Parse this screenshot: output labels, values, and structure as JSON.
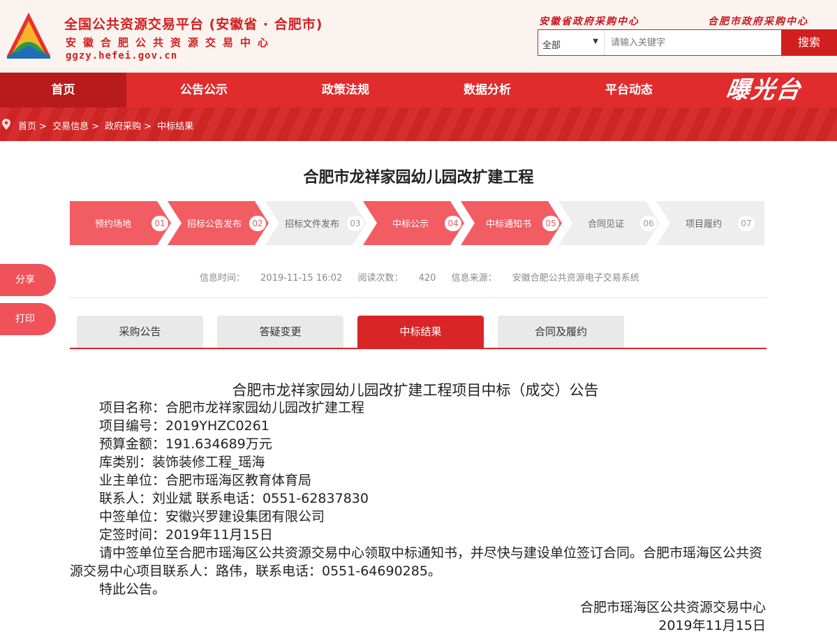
{
  "header": {
    "site_title": "全国公共资源交易平台 (安徽省 · 合肥市)",
    "site_subtitle": "安徽合肥公共资源交易中心",
    "site_domain": "ggzy.hefei.gov.cn",
    "link_province": "安徽省政府采购中心",
    "link_city": "合肥市政府采购中心",
    "search": {
      "category": "全部",
      "placeholder": "请输入关键字",
      "button": "搜索"
    }
  },
  "nav": {
    "items": [
      "首页",
      "公告公示",
      "政策法规",
      "数据分析",
      "平台动态"
    ],
    "active_index": 0,
    "brand": "曝光台"
  },
  "breadcrumb": [
    "首页",
    "交易信息",
    "政府采购",
    "中标结果"
  ],
  "page_title": "合肥市龙祥家园幼儿园改扩建工程",
  "steps": [
    {
      "label": "预约场地",
      "num": "01",
      "done": true
    },
    {
      "label": "招标公告发布",
      "num": "02",
      "done": true
    },
    {
      "label": "招标文件发布",
      "num": "03",
      "done": false
    },
    {
      "label": "中标公示",
      "num": "04",
      "done": true
    },
    {
      "label": "中标通知书",
      "num": "05",
      "done": true
    },
    {
      "label": "合同见证",
      "num": "06",
      "done": false
    },
    {
      "label": "项目履约",
      "num": "07",
      "done": false
    }
  ],
  "meta": {
    "time_label": "信息时间：",
    "time_value": "2019-11-15 16:02",
    "views_label": "阅读次数：",
    "views_value": "420",
    "source_label": "信息来源：",
    "source_value": "安徽合肥公共资源电子交易系统"
  },
  "side": {
    "share": "分享",
    "print": "打印"
  },
  "tabs": [
    "采购公告",
    "答疑变更",
    "中标结果",
    "合同及履约"
  ],
  "active_tab": 2,
  "notice": {
    "title": "合肥市龙祥家园幼儿园改扩建工程项目中标（成交）公告",
    "lines": [
      "项目名称：合肥市龙祥家园幼儿园改扩建工程",
      "项目编号：2019YHZC0261",
      "预算金额：191.634689万元",
      "库类别：装饰装修工程_瑶海",
      "业主单位：合肥市瑶海区教育体育局",
      "联系人：刘业斌 联系电话：0551-62837830",
      "中签单位：安徽兴罗建设集团有限公司",
      "定签时间：2019年11月15日"
    ],
    "paragraph": "请中签单位至合肥市瑶海区公共资源交易中心领取中标通知书，并尽快与建设单位签订合同。合肥市瑶海区公共资源交易中心项目联系人：路伟，联系电话：0551-64690285。",
    "closing": "特此公告。",
    "signer": "合肥市瑶海区公共资源交易中心",
    "date": "2019年11月15日"
  },
  "colors": {
    "brand_red": "#d11f1f",
    "nav_red": "#e02c2c",
    "step_active": "#f25c63",
    "step_inactive": "#eeeeee",
    "tab_active": "#d92525"
  }
}
